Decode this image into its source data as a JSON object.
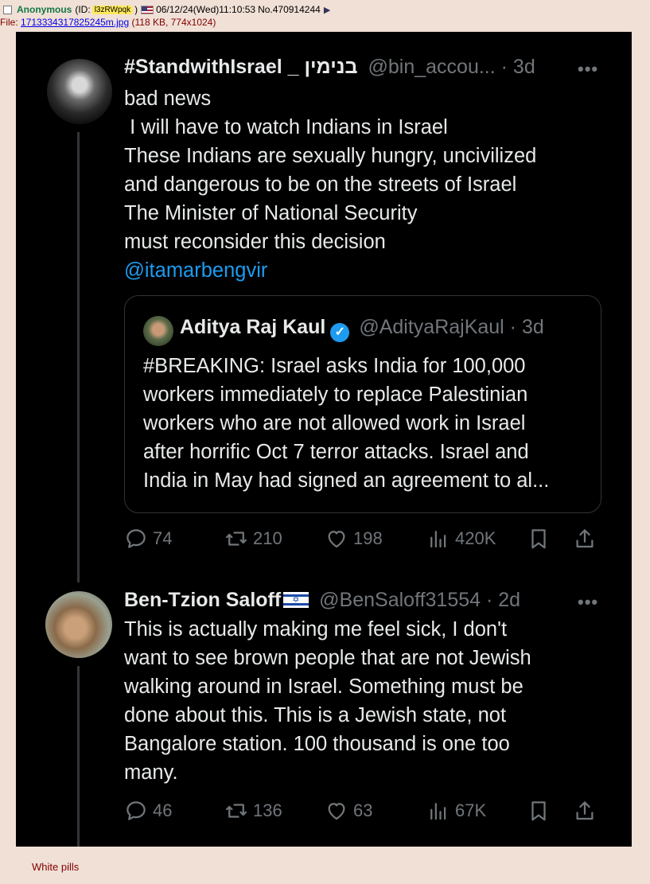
{
  "post": {
    "name": "Anonymous",
    "id_prefix": "(ID:",
    "id": "l3zRWpqk",
    "id_suffix": ")",
    "datetime": "06/12/24(Wed)11:10:53",
    "number": "No.470914244",
    "file_label": "File:",
    "filename": "1713334317825245m.jpg",
    "file_meta": "(118 KB, 774x1024)",
    "comment": "White pills"
  },
  "tweet1": {
    "display_name": "#StandwithIsrael _ בנימין",
    "handle_time": "@bin_accou... · 3d",
    "lines": [
      "bad news",
      " I will have to watch Indians in Israel",
      "These Indians are sexually hungry, uncivilized",
      "and dangerous to be on the streets of Israel",
      "The Minister of National Security",
      "must reconsider this decision"
    ],
    "mention": "@itamarbengvir",
    "more": "•••",
    "quote": {
      "display_name": "Aditya Raj Kaul",
      "handle_time": "@AdityaRajKaul · 3d",
      "lines": [
        "#BREAKING: Israel asks India for 100,000",
        "workers immediately to replace Palestinian",
        "workers who are not allowed work in Israel",
        "after horrific Oct 7 terror attacks. Israel and",
        "India in May had signed an agreement to al..."
      ]
    },
    "stats": {
      "replies": "74",
      "retweets": "210",
      "likes": "198",
      "views": "420K"
    }
  },
  "tweet2": {
    "display_name": "Ben-Tzion Saloff",
    "flag_icon": "israel-flag-emoji",
    "handle_time": "@BenSaloff31554 · 2d",
    "lines": [
      "This is actually making me feel sick, I don't",
      "want to see brown people that are not Jewish",
      "walking around in Israel. Something must be",
      "done about this. This is a Jewish state, not",
      "Bangalore station. 100 thousand is one too",
      "many."
    ],
    "more": "•••",
    "stats": {
      "replies": "46",
      "retweets": "136",
      "likes": "63",
      "views": "67K"
    }
  },
  "colors": {
    "board_bg": "#f0e0d6",
    "name_green": "#117743",
    "tweet_bg": "#000000",
    "tweet_text": "#e7e9ea",
    "muted": "#71767b",
    "link_blue": "#1d9bf0"
  }
}
